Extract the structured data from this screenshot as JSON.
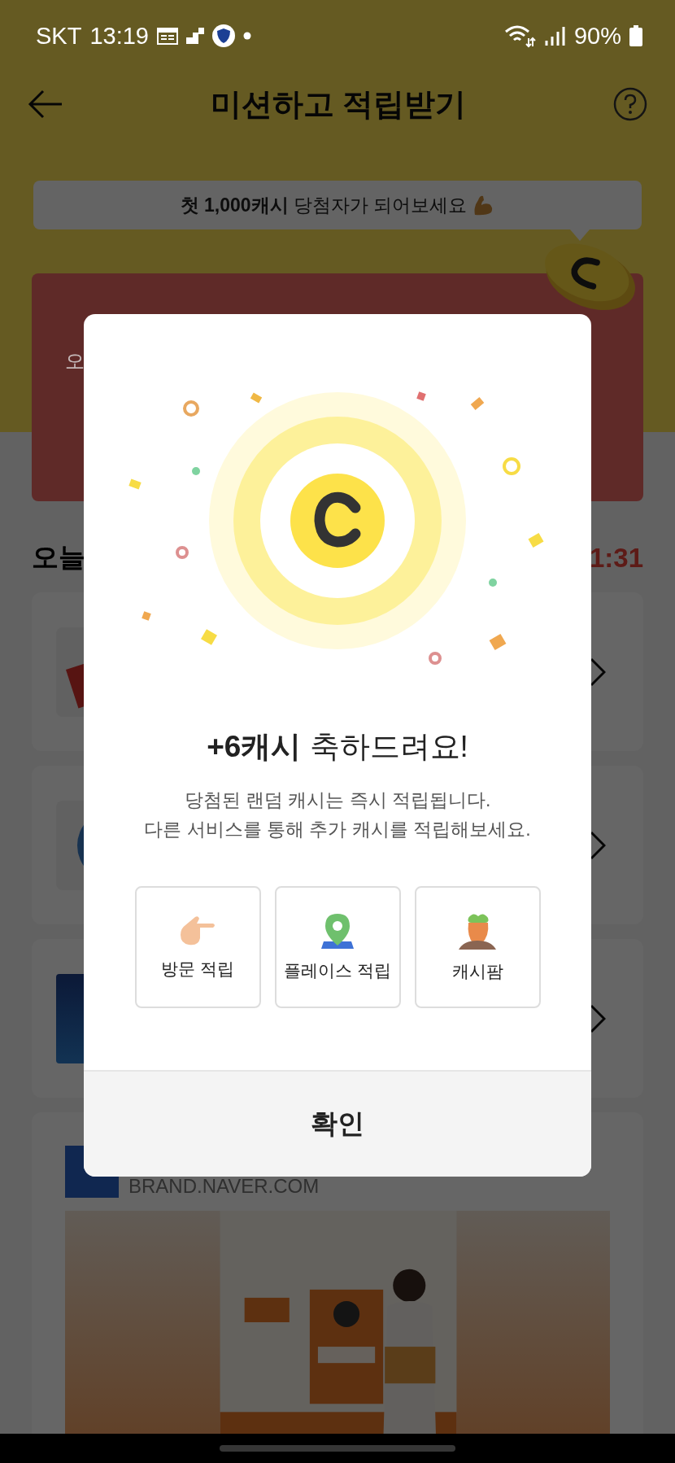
{
  "status_bar": {
    "carrier": "SKT",
    "time": "13:19",
    "battery": "90%"
  },
  "header": {
    "title": "미션하고 적립받기"
  },
  "tooltip": {
    "text": "**첫 1,000캐시** 당첨자가 되어보세요"
  },
  "promo_card": {
    "subtitle": "오"
  },
  "section": {
    "title": "오늘",
    "timer": "1:31"
  },
  "missions": [
    {
      "kind": "tag"
    },
    {
      "kind": "circle"
    },
    {
      "kind": "square"
    }
  ],
  "ad": {
    "source": "BRAND.NAVER.COM"
  },
  "dialog": {
    "title": "**+6캐시** 축하드려요!",
    "message": [
      "당첨된 랜덤 캐시는 즉시 적립됩니다.",
      "다른 서비스를 통해 추가 캐시를 적립해보세요."
    ],
    "options": [
      {
        "kind": "visit",
        "label": "방문 적립"
      },
      {
        "kind": "place",
        "label": "플레이스 적립"
      },
      {
        "kind": "farm",
        "label": "캐시팜"
      }
    ],
    "confirm": "확인"
  }
}
